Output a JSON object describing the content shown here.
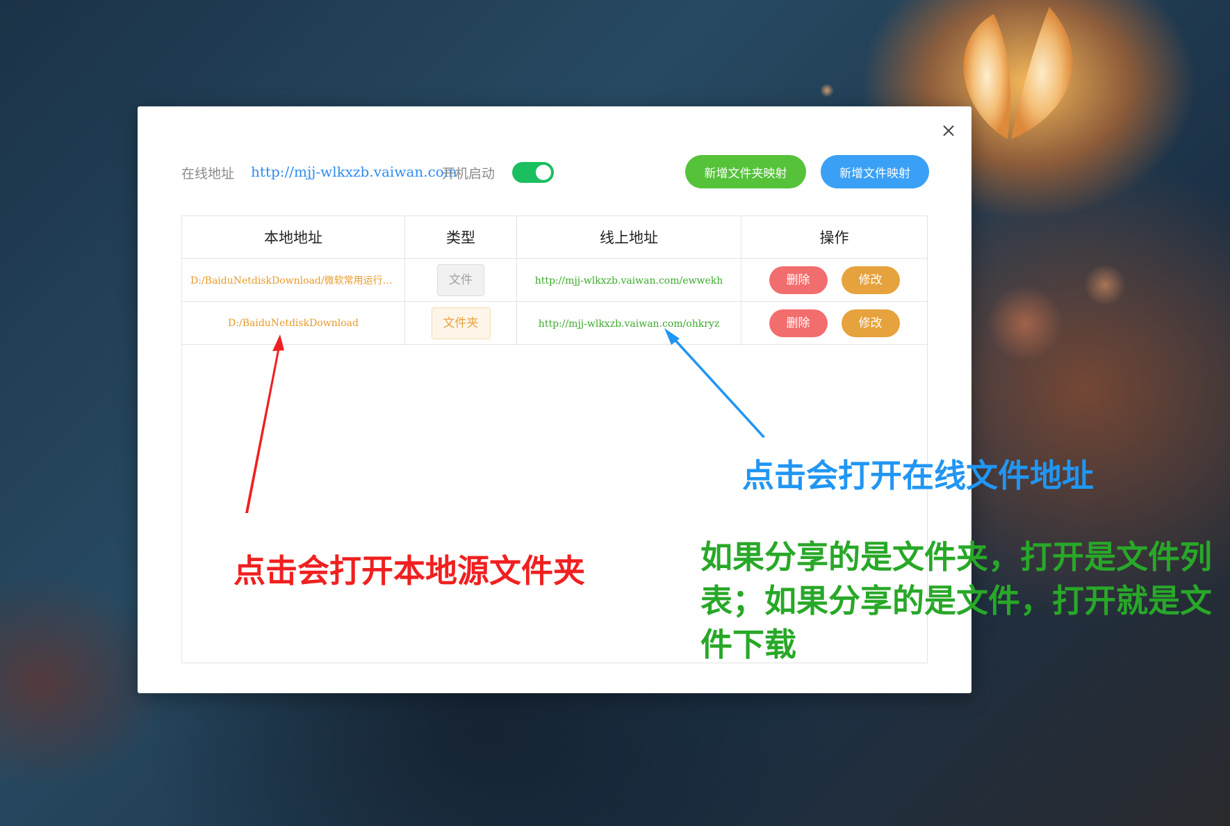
{
  "header": {
    "online_label": "在线地址",
    "online_url": "http://mjj-wlkxzb.vaiwan.com",
    "boot_label": "开机启动",
    "boot_enabled": true,
    "add_folder_label": "新增文件夹映射",
    "add_file_label": "新增文件映射"
  },
  "table": {
    "headers": [
      "本地地址",
      "类型",
      "线上地址",
      "操作"
    ],
    "rows": [
      {
        "local": "D:/BaiduNetdiskDownload/微软常用运行库...",
        "type": "文件",
        "online": "http://mjj-wlkxzb.vaiwan.com/ewwekh",
        "delete": "删除",
        "edit": "修改"
      },
      {
        "local": "D:/BaiduNetdiskDownload",
        "type": "文件夹",
        "online": "http://mjj-wlkxzb.vaiwan.com/ohkryz",
        "delete": "删除",
        "edit": "修改"
      }
    ]
  },
  "annotations": {
    "blue": "点击会打开在线文件地址",
    "red": "点击会打开本地源文件夹",
    "green": "如果分享的是文件夹，打开是文件列表；如果分享的是文件，打开就是文件下载"
  },
  "colors": {
    "toggle_on": "#1bbf5f",
    "add_folder_btn": "#55c23a",
    "add_file_btn": "#3aa0f5",
    "delete_btn": "#f26d6d",
    "edit_btn": "#e6a23c",
    "annotation_blue": "#2196f3",
    "annotation_red": "#f02020",
    "annotation_green": "#28a828"
  }
}
